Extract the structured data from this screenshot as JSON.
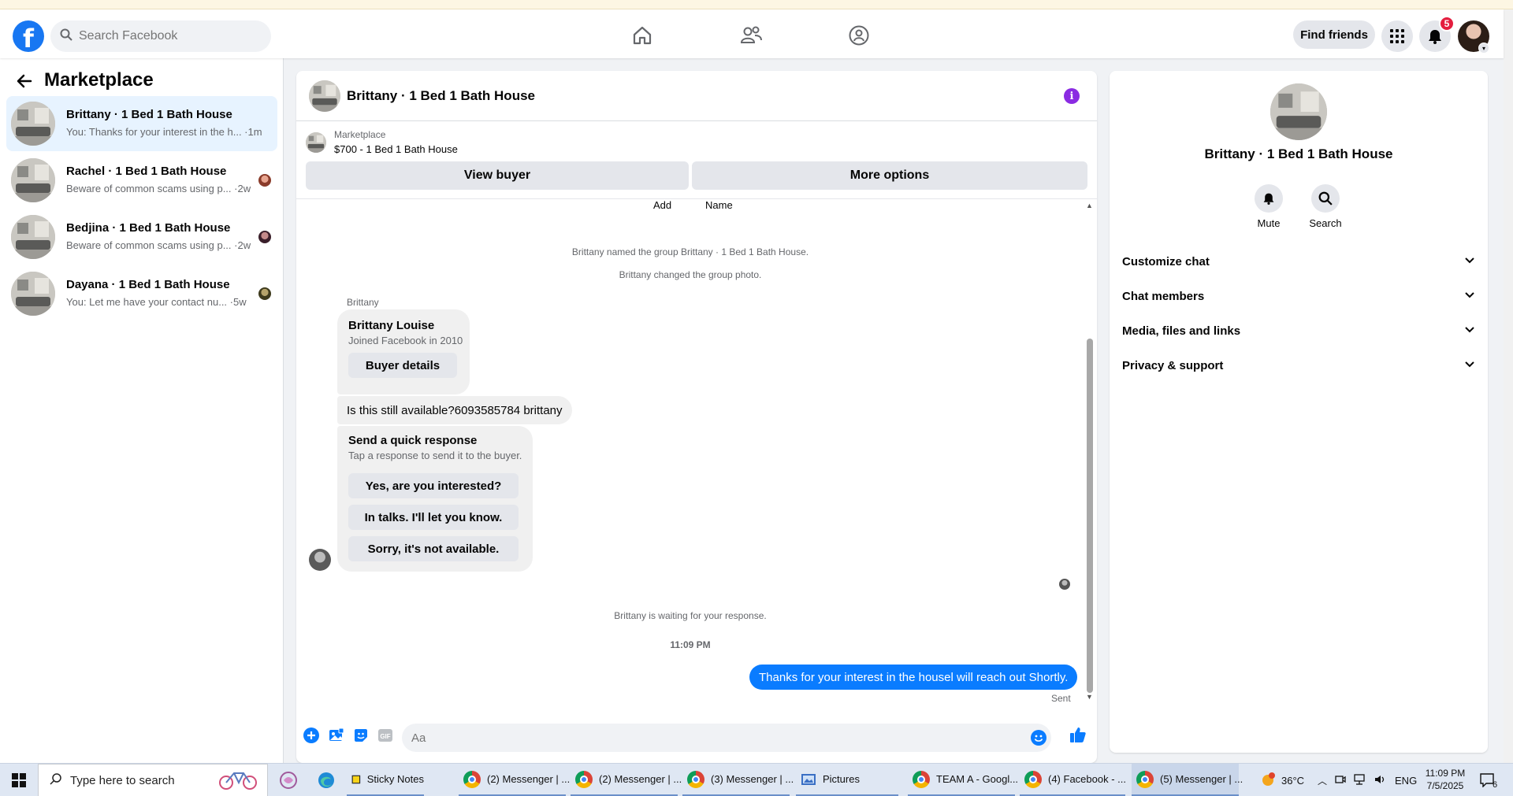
{
  "header": {
    "search_placeholder": "Search Facebook",
    "find_friends": "Find friends",
    "notif_count": "5"
  },
  "sidebar": {
    "title": "Marketplace",
    "conversations": [
      {
        "title": "Brittany · 1 Bed 1 Bath House",
        "preview": "You: Thanks for your interest in the h... ·1m",
        "active": true
      },
      {
        "title": "Rachel · 1 Bed 1 Bath House",
        "preview": "Beware of common scams using p... ·2w",
        "active": false
      },
      {
        "title": "Bedjina · 1 Bed 1 Bath House",
        "preview": "Beware of common scams using p... ·2w",
        "active": false
      },
      {
        "title": "Dayana · 1 Bed 1 Bath House",
        "preview": "You: Let me have your contact nu... ·5w",
        "active": false
      }
    ]
  },
  "chat": {
    "title": "Brittany · 1 Bed 1 Bath House",
    "marketplace_label": "Marketplace",
    "listing": "$700 - 1 Bed 1 Bath House",
    "view_buyer": "View buyer",
    "more_options": "More options",
    "partial_add": "Add",
    "partial_name": "Name",
    "note_named": "Brittany named the group Brittany · 1 Bed 1 Bath House.",
    "note_photo": "Brittany changed the group photo.",
    "sender": "Brittany",
    "card_name": "Brittany Louise",
    "card_sub": "Joined Facebook in 2010",
    "card_button": "Buyer details",
    "message": "Is this still available?6093585784 brittany",
    "qr_title": "Send a quick response",
    "qr_sub": "Tap a response to send it to the buyer.",
    "qr_options": [
      "Yes, are you interested?",
      "In talks. I'll let you know.",
      "Sorry, it's not available."
    ],
    "waiting_note": "Brittany is waiting for your response.",
    "time": "11:09 PM",
    "out_message": "Thanks for your interest in the housel will reach out Shortly.",
    "sent_label": "Sent",
    "composer_placeholder": "Aa"
  },
  "right_panel": {
    "title": "Brittany · 1 Bed 1 Bath House",
    "mute": "Mute",
    "search": "Search",
    "sections": [
      "Customize chat",
      "Chat members",
      "Media, files and links",
      "Privacy & support"
    ]
  },
  "taskbar": {
    "search_placeholder": "Type here to search",
    "items": [
      "Sticky Notes",
      "(2) Messenger | ...",
      "(2) Messenger | ...",
      "(3) Messenger | ...",
      "Pictures",
      "TEAM A - Googl...",
      "(4) Facebook - ...",
      "(5) Messenger | ..."
    ],
    "weather": "36°C",
    "lang": "ENG",
    "clock_time": "11:09 PM",
    "clock_date": "7/5/2025",
    "notif_count": "6"
  },
  "colors": {
    "brand": "#1877f2",
    "outgoing_bubble": "#0a7cff",
    "badge": "#e41e3f",
    "active_row": "#e7f3ff"
  }
}
